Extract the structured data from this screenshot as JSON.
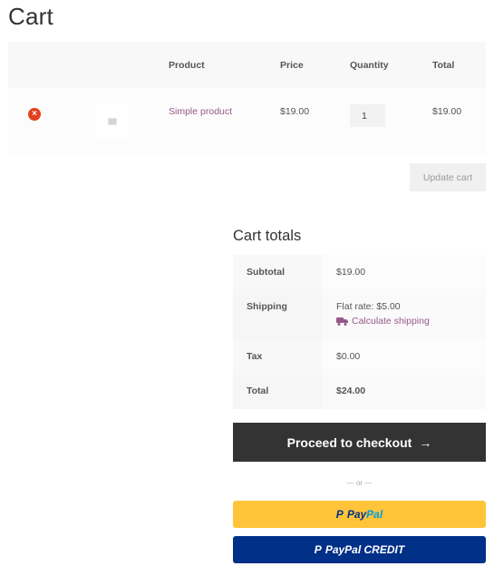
{
  "page": {
    "title": "Cart"
  },
  "cart": {
    "headers": {
      "product": "Product",
      "price": "Price",
      "quantity": "Quantity",
      "total": "Total"
    },
    "items": [
      {
        "name": "Simple product",
        "price": "$19.00",
        "quantity": "1",
        "total": "$19.00"
      }
    ],
    "remove_icon": "×",
    "update_label": "Update cart"
  },
  "totals": {
    "title": "Cart totals",
    "subtotal_label": "Subtotal",
    "subtotal": "$19.00",
    "shipping_label": "Shipping",
    "shipping": "Flat rate: $5.00",
    "calc_shipping": "Calculate shipping",
    "tax_label": "Tax",
    "tax": "$0.00",
    "total_label": "Total",
    "total": "$24.00"
  },
  "checkout": {
    "label": "Proceed to checkout",
    "arrow": "→",
    "or": "— or —"
  },
  "paypal": {
    "pay": "Pay",
    "pal": "Pal",
    "credit": "PayPal CREDIT",
    "mark": "P"
  },
  "colors": {
    "accent": "#96588a",
    "remove": "#e2401c",
    "paypal_yellow": "#ffc439",
    "paypal_blue": "#003087",
    "checkout_bg": "#333333"
  }
}
